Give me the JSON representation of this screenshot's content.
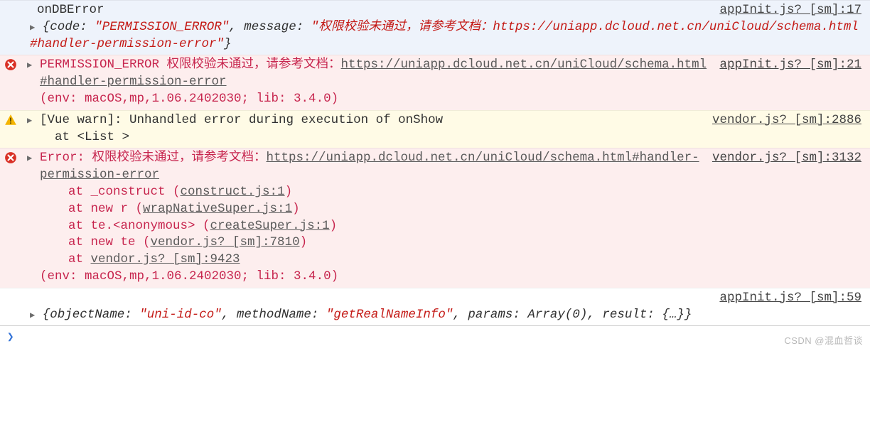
{
  "entries": [
    {
      "type": "log",
      "title": "onDBError",
      "source": "appInit.js? [sm]:17",
      "objPrefix": "{code: ",
      "codeStr": "\"PERMISSION_ERROR\"",
      "midSep": ", message: ",
      "msgStr": "\"权限校验未通过，请参考文档：https://uniapp.dcloud.net.cn/uniCloud/schema.html#handler-permission-error\"",
      "objSuffix": "}"
    },
    {
      "type": "error",
      "source": "appInit.js? [sm]:21",
      "prefix": "PERMISSION_ERROR 权限校验未通过，请参考文档：",
      "link": "https://uniapp.dcloud.net.cn/uniCloud/schema.html#handler-permission-error",
      "env": "(env: macOS,mp,1.06.2402030; lib: 3.4.0)"
    },
    {
      "type": "warn",
      "source": "vendor.js? [sm]:2886",
      "line1": "[Vue warn]: Unhandled error during execution of onShow ",
      "line2": "  at <List >"
    },
    {
      "type": "error2",
      "source": "vendor.js? [sm]:3132",
      "prefix": "Error: 权限校验未通过，请参考文档：",
      "link": "https://uniapp.dcloud.net.cn/uniCloud/schema.html#handler-permission-error",
      "stack": [
        {
          "pre": "at _construct (",
          "file": "construct.js:1",
          "post": ")"
        },
        {
          "pre": "at new r (",
          "file": "wrapNativeSuper.js:1",
          "post": ")"
        },
        {
          "pre": "at te.<anonymous> (",
          "file": "createSuper.js:1",
          "post": ")"
        },
        {
          "pre": "at new te (",
          "file": "vendor.js? [sm]:7810",
          "post": ")"
        },
        {
          "pre": "at ",
          "file": "vendor.js? [sm]:9423",
          "post": ""
        }
      ],
      "env": "(env: macOS,mp,1.06.2402030; lib: 3.4.0)"
    },
    {
      "type": "log2",
      "source": "appInit.js? [sm]:59",
      "p1": "{objectName: ",
      "s1": "\"uni-id-co\"",
      "p2": ", methodName: ",
      "s2": "\"getRealNameInfo\"",
      "p3": ", params: Array(0), result: {…}}"
    }
  ],
  "prompt": "❯",
  "watermark": "CSDN @混血哲谈"
}
